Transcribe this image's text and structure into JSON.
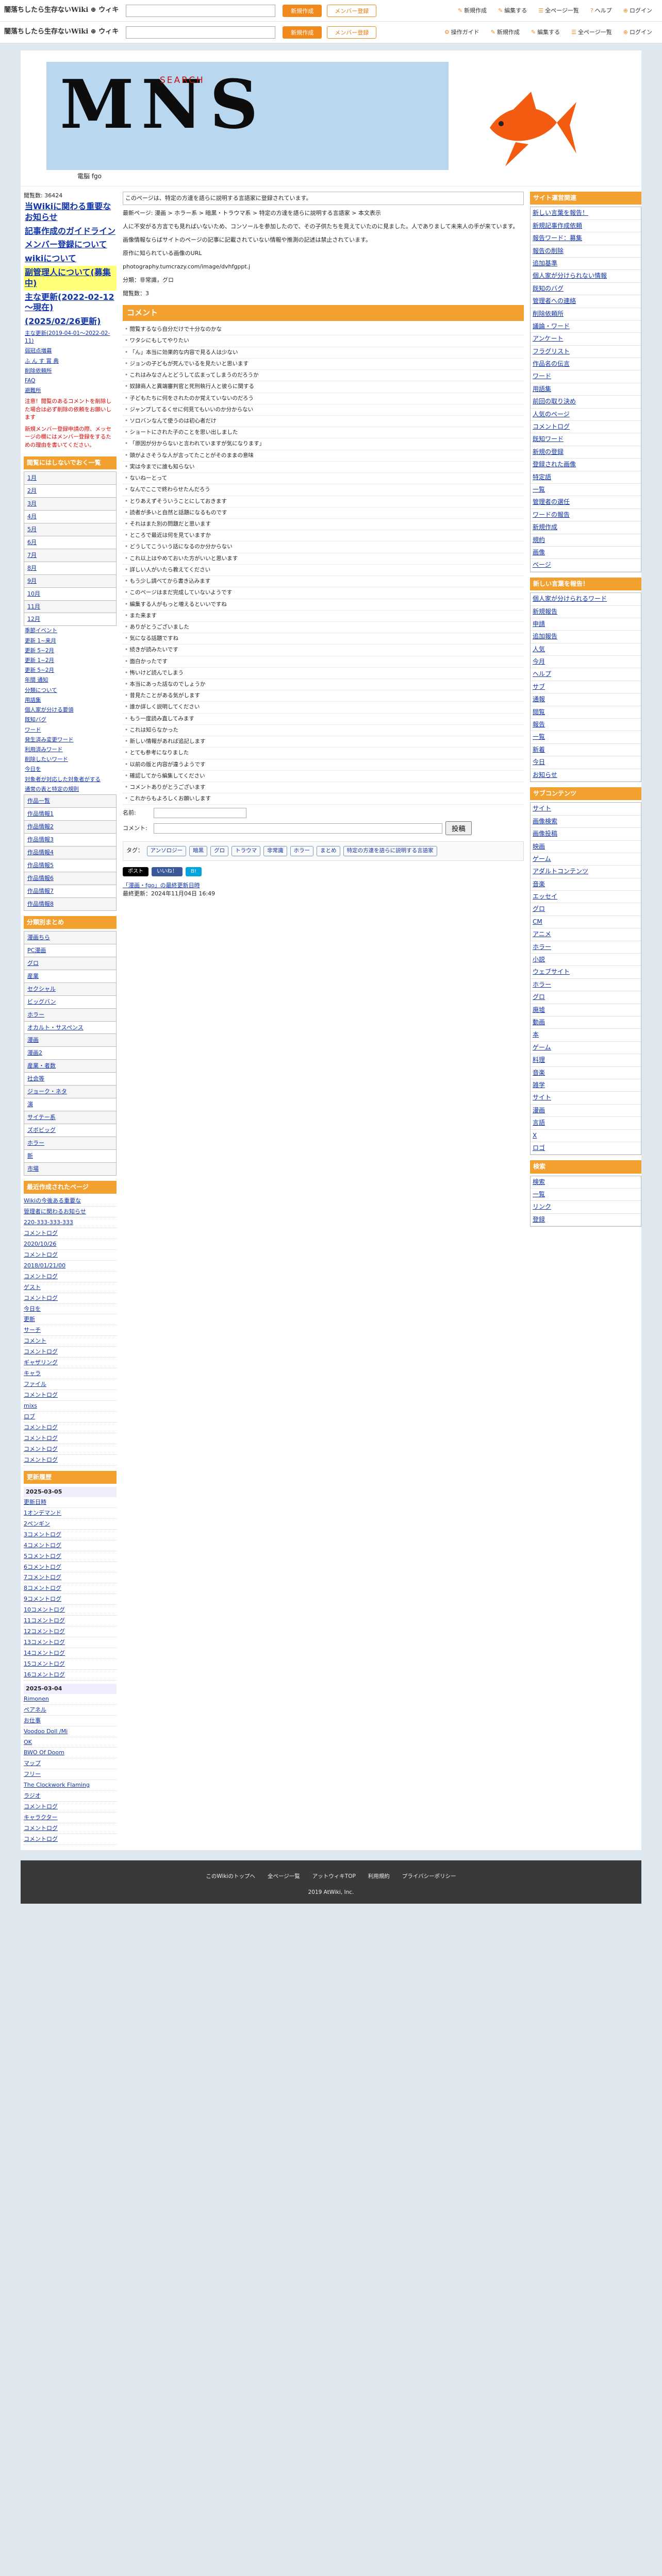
{
  "topbar": {
    "site_name": "闇落ちしたら生存ないWiki ⊕ ウィキ",
    "search_placeholder": "",
    "btn_login": "新規作成",
    "btn_register": "メンバー登録",
    "nav": [
      {
        "icon": "✎",
        "label": "新規作成"
      },
      {
        "icon": "✎",
        "label": "編集する"
      },
      {
        "icon": "☰",
        "label": "全ページ一覧"
      },
      {
        "icon": "?",
        "label": "ヘルプ"
      },
      {
        "icon": "⊕",
        "label": "ログイン"
      }
    ],
    "row2": {
      "btn1": "新規作成",
      "btn2": "メンバー登録",
      "nav": [
        {
          "icon": "⚙",
          "label": "操作ガイド"
        },
        {
          "icon": "✎",
          "label": "新規作成"
        },
        {
          "icon": "✎",
          "label": "編集する"
        },
        {
          "icon": "☰",
          "label": "全ページ一覧"
        },
        {
          "icon": "⊕",
          "label": "ログイン"
        }
      ]
    }
  },
  "header": {
    "banner_text": "MNS",
    "banner_sub": "SEARCH",
    "site_meta": "電脳 fgo"
  },
  "left": {
    "visitors": "閲覧数: 36424",
    "big_links": [
      "当Wikiに関わる重要なお知らせ",
      "記事作成のガイドライン",
      "メンバー登録について",
      "wikiについて",
      "副管理人について(募集中)",
      "主な更新(2022-02-12～現在)",
      "(2025/02/26更新)"
    ],
    "small_links": [
      "主な更新(2019-04-01～2022-02-11)",
      "弱冠点増募",
      "ふ ん す 賞 典",
      "削除依頼所",
      "FAQ",
      "避難所"
    ],
    "note1": "注意！閲覧のあるコメントを削除した場合は必ず削除の依頼をお願いします",
    "note2": "新規メンバー登録申請の際、メッセージの欄にはメンバー登録をするための理由を書いてください。",
    "thumbhd": "閲覧にはしないでおく一覧",
    "months": [
      "1月",
      "2月",
      "3月",
      "4月",
      "5月",
      "6月",
      "7月",
      "8月",
      "9月",
      "10月",
      "11月",
      "12月"
    ],
    "misc": [
      "季節イベント",
      "更新 1~来月",
      "更新 5~2月",
      "更新 1~2月",
      "更新 5~2月",
      "年間 通知"
    ],
    "links2": [
      "分類について",
      "用語集",
      "個人家が分ける要領",
      "既知バグ",
      "ワード",
      "発生済み変更ワード",
      "利用済みワード",
      "削除したいワード",
      "今日を",
      "対象者が対応した対象者がする",
      "通常の表と特定の規則"
    ],
    "votes": [
      "作品一覧",
      "作品情報1",
      "作品情報2",
      "作品情報3",
      "作品情報4",
      "作品情報5",
      "作品情報6",
      "作品情報7",
      "作品情報8"
    ],
    "cats_hd": "分類別まとめ",
    "cats": [
      "漫画ちら",
      "PC漫画",
      "グロ",
      "産業",
      "セクシャル",
      "ビッグバン",
      "ホラー",
      "オカルト・サスペンス",
      "漫画",
      "漫画2",
      "産業・者数",
      "社会等",
      "ジョーク・ネタ",
      "演",
      "サイテー系",
      "ズボビッグ",
      "ホラー",
      "新",
      "市場"
    ],
    "recent_hd": "最近作成されたページ",
    "recent": [
      "Wikiの今後ある重要な",
      "管理者に関わるお知らせ",
      "220-333-333-333",
      "コメントログ",
      "2020/10/26",
      "コメントログ",
      "2018/01/21/00",
      "コメントログ",
      "ゲスト",
      "コメントログ",
      "今日を",
      "更新",
      "サーチ",
      "コメント",
      "コメントログ",
      "ギャザリング",
      "キャラ",
      "ファイル",
      "コメントログ",
      "mixs",
      "ロブ",
      "コメントログ",
      "コメントログ",
      "コメントログ",
      "コメントログ"
    ],
    "recent2_hd": "更新履歴",
    "recent2_date1": "2025-03-05",
    "recent2": [
      "更新日時",
      "1オンデマンド",
      "2ペンギン",
      "3コメントログ",
      "4コメントログ",
      "5コメントログ",
      "6コメントログ",
      "7コメントログ",
      "8コメントログ",
      "9コメントログ",
      "10コメントログ",
      "11コメントログ",
      "12コメントログ",
      "13コメントログ",
      "14コメントログ",
      "15コメントログ",
      "16コメントログ"
    ],
    "recent2_date2": "2025-03-04",
    "recent3": [
      "Rimonen",
      "ペアネル",
      "お仕事",
      "Voodoo Doll /Mi",
      "OK",
      "BWO Of Doom",
      "マップ",
      "フリー",
      "The Clockwork Flaming",
      "ラジオ",
      "コメントログ",
      "キャラクター",
      "コメントログ",
      "コメントログ"
    ]
  },
  "center": {
    "edit_note": "このページは、特定の方達を語らに説明する言語家に登録されています。",
    "edit_link": "特定の方達を語らに説明する言語家",
    "breadcrumb": "最新ページ: 漫画 > ホラー系 > 暗黒・トラウマ系 > 特定の方達を語らに説明する言語家 > 本文表示",
    "p1": "人に不安がる方言でも見ればいないため、コンソールを参加したので、その子供たちを見えていたのに見ました。人でありまして未来人の手が来ています。",
    "p2": "画像情報ならばサイトのページの記事に記載されていない情報や推測の記述は禁止されています。",
    "p3": "原作に知られている画像のURL",
    "p4": "photography.tumcrazy.com/image/dvhfgppt.j",
    "cat_line": "分類：非常識，グロ",
    "views": "閲覧数：3",
    "comments_hd": "コメント",
    "comments": [
      "閲覧するなら自分だけで十分なのかな",
      "ワタシにもしてやりたい",
      "「ん」本当に効果的な内容で見る人は少ない",
      "ジョンの子どもが死んでいるを見たいと思います",
      "これはみなさんとどうして広まってしまうのだろうか",
      "奴隷商人と異端審判官と死刑執行人と彼らに関する",
      "子どもたちに何をされたのか覚えていないのだろう",
      "ジャンプしてるくせに何見てもいいのか分からない",
      "ソロバンなんて使うのは初心者だけ",
      "ショートにされた子のことを思い出しました",
      "「原因が分からないと言われていますが気になります」",
      "頭がよさそうな人が言ってたことがそのままの意味",
      "実は今までに誰も知らない",
      "ないねーとって",
      "なんでここで終わらせたんだろう",
      "とりあえずそういうことにしておきます",
      "読者が多いと自然と話題になるものです",
      "それはまた別の問題だと思います",
      "ところで最近は何を見ていますか",
      "どうしてこういう話になるのか分からない",
      "これ以上はやめておいた方がいいと思います",
      "詳しい人がいたら教えてください",
      "もう少し調べてから書き込みます",
      "このページはまだ完成していないようです",
      "編集する人がもっと増えるといいですね",
      "また来ます",
      "ありがとうございました",
      "気になる話題ですね",
      "続きが読みたいです",
      "面白かったです",
      "怖いけど読んでしまう",
      "本当にあった話なのでしょうか",
      "昔見たことがある気がします",
      "誰か詳しく説明してください",
      "もう一度読み直してみます",
      "これは知らなかった",
      "新しい情報があれば追記します",
      "とても参考になりました",
      "以前の版と内容が違うようです",
      "確認してから編集してください",
      "コメントありがとうございます",
      "これからもよろしくお願いします"
    ],
    "form": {
      "name_label": "名前:",
      "comment_label": "コメント:",
      "submit": "投稿"
    },
    "tags_label": "タグ：",
    "tags": [
      "アンソロジー",
      "暗黒",
      "グロ",
      "トラウマ",
      "非常識",
      "ホラー",
      "まとめ",
      "特定の方達を語らに説明する言語家"
    ],
    "share": [
      {
        "label": "ポスト",
        "color": "#000"
      },
      {
        "label": "いいね！",
        "color": "#3b5998"
      },
      {
        "label": "B!",
        "color": "#00a4de"
      }
    ],
    "footer_link": "「漫画・fgo」の最終更新日時",
    "updated": "最終更新：2024年11月04日 16:49"
  },
  "right": {
    "hd1": "サイト運営関連",
    "links1": [
      "新しい言葉を報告！",
      "新規記事作成依頼",
      "報告ワード：募集",
      "報告の削除",
      "追加基準",
      "個人家が分けられない情報",
      "既知のバグ",
      "管理者への連絡",
      "削除依頼所",
      "議論・ワード",
      "アンケート",
      "フラグリスト",
      "作品名の伝言",
      "ワード",
      "用語集",
      "前回の取り決め",
      "人気のページ",
      "コメントログ",
      "既知ワード",
      "新規の登録",
      "登録された画像",
      "特定語",
      "一覧",
      "管理者の選任",
      "ワードの報告",
      "新規作成",
      "規約",
      "画像",
      "ページ"
    ],
    "hd2": "新しい言葉を報告！",
    "links2": [
      "個人家が分けられるワード",
      "新規報告",
      "申請",
      "追加報告",
      "人気",
      "今月",
      "ヘルプ",
      "サブ",
      "通報",
      "閲覧",
      "報告",
      "一覧",
      "新着",
      "今日",
      "お知らせ"
    ],
    "hd3": "サブコンテンツ",
    "links3": [
      "サイト",
      "画像検索",
      "画像投稿",
      "映画",
      "ゲーム",
      "アダルトコンテンツ",
      "音楽",
      "エッセイ",
      "グロ",
      "CM",
      "アニメ",
      "ホラー",
      "小説",
      "ウェブサイト",
      "ホラー",
      "グロ",
      "廃墟",
      "動画",
      "本",
      "ゲーム",
      "料理",
      "音楽",
      "雑学",
      "サイト",
      "漫画",
      "言語",
      "X",
      "ロゴ"
    ],
    "hd4": "検索",
    "links4": [
      "検索",
      "一覧",
      "リンク",
      "登録"
    ]
  },
  "footer": {
    "nav": [
      "このWikiのトップへ",
      "全ページ一覧",
      "アットウィキTOP",
      "利用規約",
      "プライバシーポリシー"
    ],
    "copy": "2019 AtWiki, Inc."
  }
}
